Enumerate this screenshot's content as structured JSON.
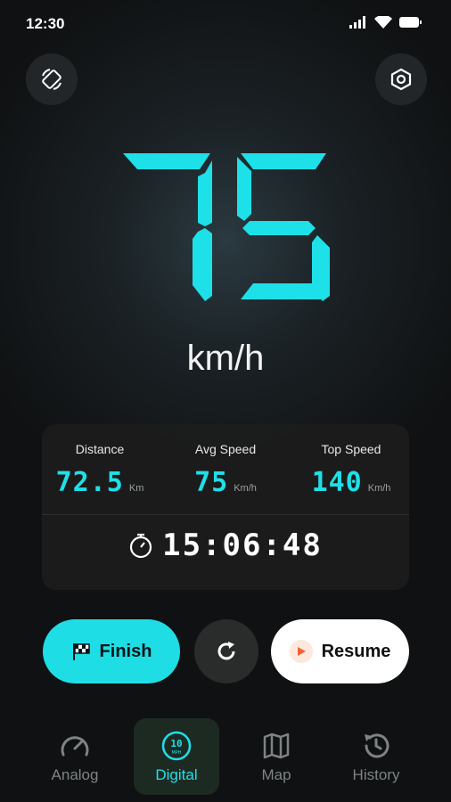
{
  "status_bar": {
    "time": "12:30"
  },
  "speedometer": {
    "speed": "75",
    "unit": "km/h"
  },
  "stats": [
    {
      "label": "Distance",
      "value": "72.5",
      "unit": "Km"
    },
    {
      "label": "Avg Speed",
      "value": "75",
      "unit": "Km/h"
    },
    {
      "label": "Top Speed",
      "value": "140",
      "unit": "Km/h"
    }
  ],
  "timer": {
    "value": "15:06:48"
  },
  "actions": {
    "finish_label": "Finish",
    "resume_label": "Resume"
  },
  "nav": [
    {
      "label": "Analog",
      "icon": "gauge-icon"
    },
    {
      "label": "Digital",
      "icon": "digital-speed-icon",
      "badge_top": "10",
      "badge_bottom": "MPH"
    },
    {
      "label": "Map",
      "icon": "map-icon"
    },
    {
      "label": "History",
      "icon": "history-icon"
    }
  ],
  "colors": {
    "accent": "#1ee0e8",
    "button_dark": "#2a2c2c",
    "play_orange": "#f0623a"
  }
}
